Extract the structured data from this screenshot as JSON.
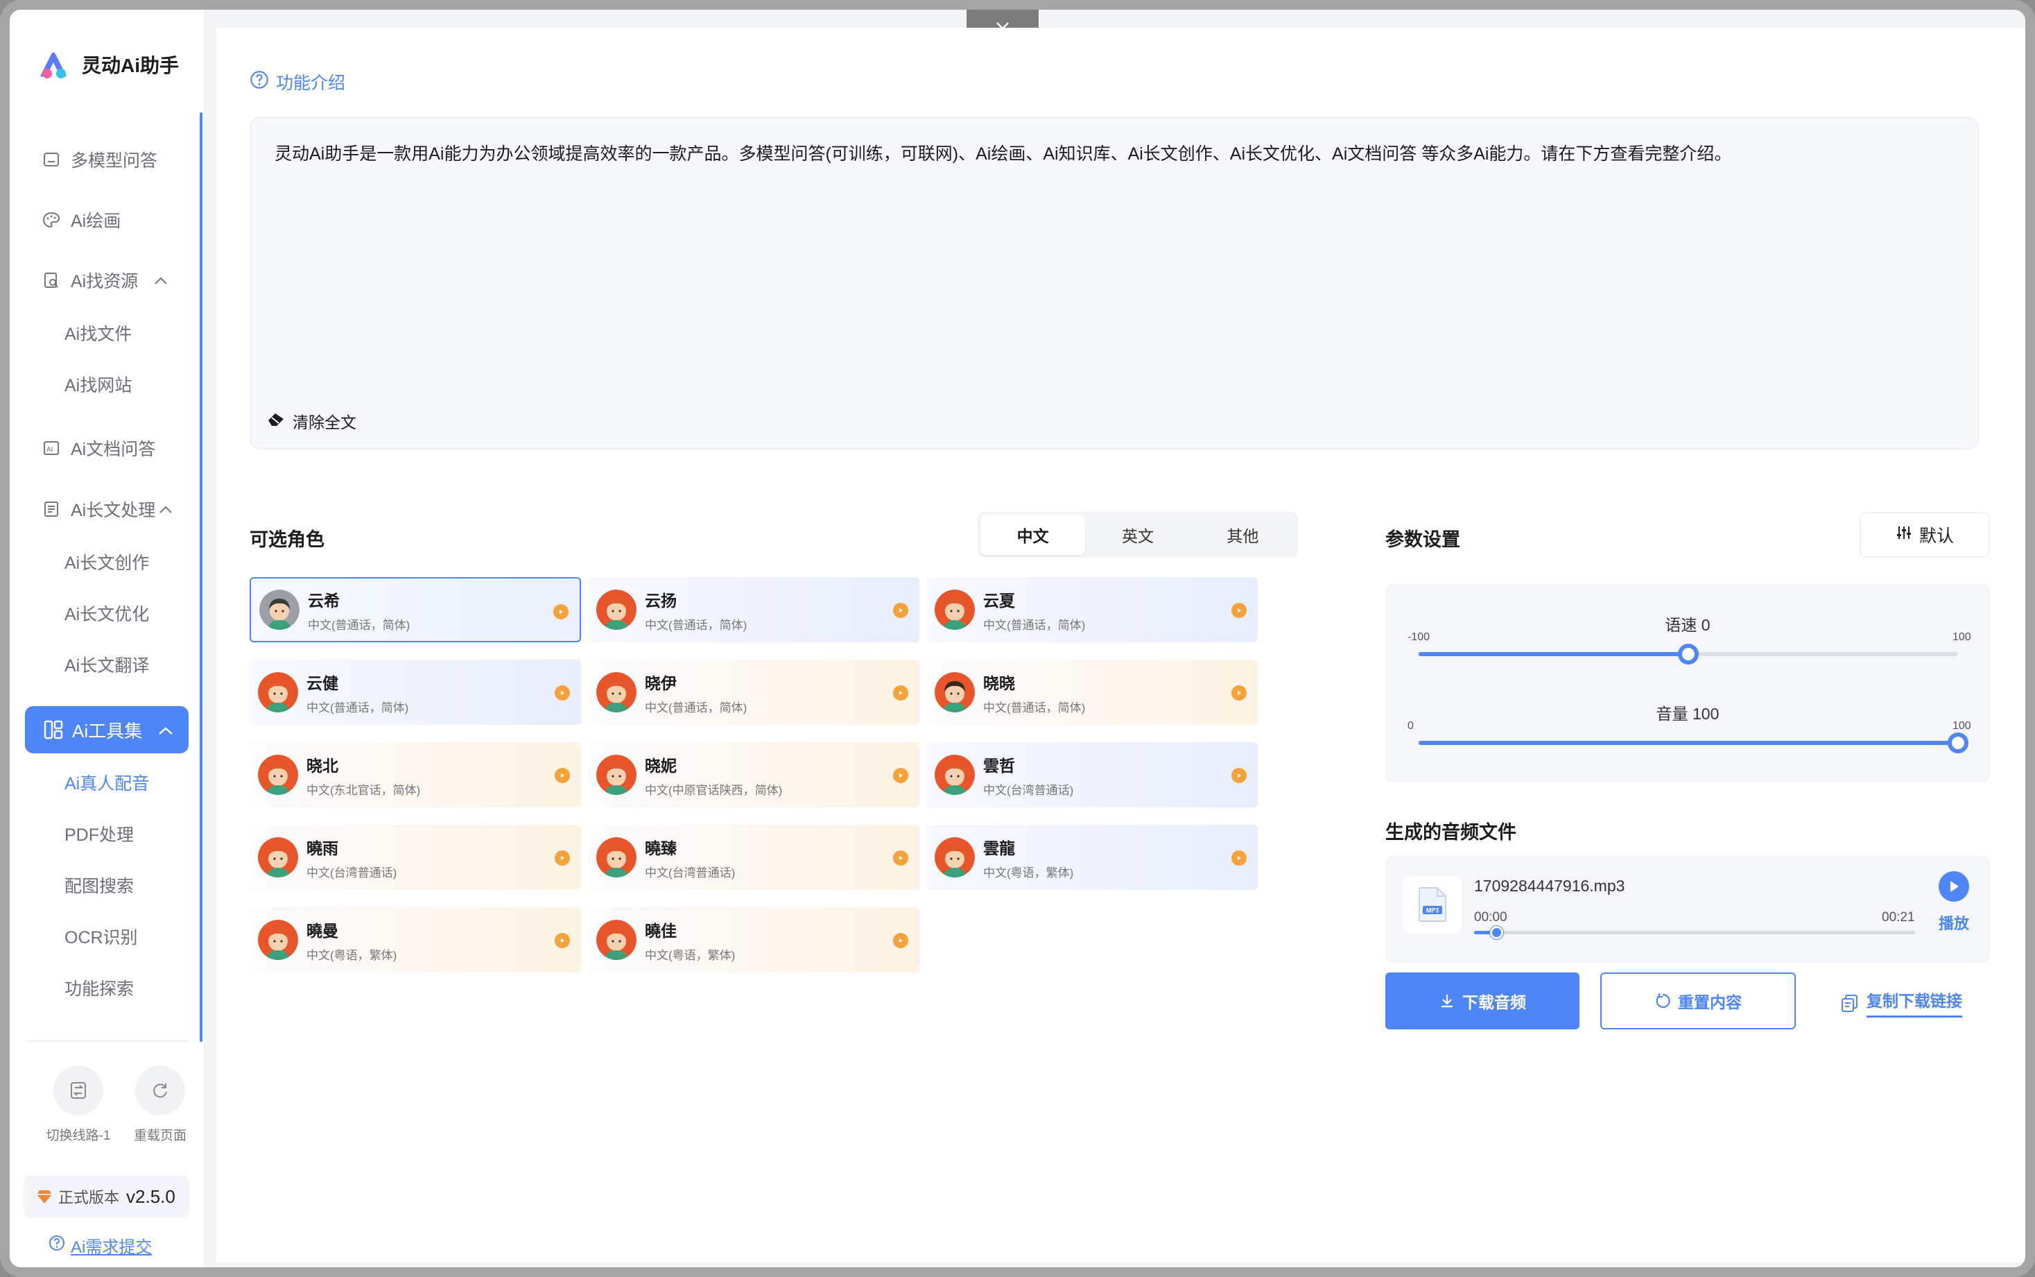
{
  "app": {
    "name": "灵动Ai助手"
  },
  "sidebar": {
    "items": [
      {
        "label": "多模型问答"
      },
      {
        "label": "Ai绘画"
      },
      {
        "label": "Ai找资源"
      },
      {
        "label": "Ai找文件"
      },
      {
        "label": "Ai找网站"
      },
      {
        "label": "Ai文档问答"
      },
      {
        "label": "Ai长文处理"
      },
      {
        "label": "Ai长文创作"
      },
      {
        "label": "Ai长文优化"
      },
      {
        "label": "Ai长文翻译"
      },
      {
        "label": "Ai工具集"
      },
      {
        "label": "Ai真人配音"
      },
      {
        "label": "PDF处理"
      },
      {
        "label": "配图搜索"
      },
      {
        "label": "OCR识别"
      },
      {
        "label": "功能探索"
      }
    ],
    "switch_line": "切换线路-1",
    "reload_page": "重载页面",
    "version_label": "正式版本",
    "version_number": "v2.5.0",
    "feedback": "Ai需求提交"
  },
  "intro": {
    "link": "功能介绍",
    "text": "灵动Ai助手是一款用Ai能力为办公领域提高效率的一款产品。多模型问答(可训练，可联网)、Ai绘画、Ai知识库、Ai长文创作、Ai长文优化、Ai文档问答 等众多Ai能力。请在下方查看完整介绍。",
    "clear": "清除全文"
  },
  "roles": {
    "title": "可选角色",
    "tabs": [
      "中文",
      "英文",
      "其他"
    ],
    "voices": [
      {
        "name": "云希",
        "desc": "中文(普通话，简体)"
      },
      {
        "name": "云扬",
        "desc": "中文(普通话，简体)"
      },
      {
        "name": "云夏",
        "desc": "中文(普通话，简体)"
      },
      {
        "name": "云健",
        "desc": "中文(普通话，简体)"
      },
      {
        "name": "晓伊",
        "desc": "中文(普通话，简体)"
      },
      {
        "name": "晓晓",
        "desc": "中文(普通话，简体)"
      },
      {
        "name": "晓北",
        "desc": "中文(东北官话，简体)"
      },
      {
        "name": "晓妮",
        "desc": "中文(中原官话陕西，简体)"
      },
      {
        "name": "雲哲",
        "desc": "中文(台湾普通话)"
      },
      {
        "name": "曉雨",
        "desc": "中文(台湾普通话)"
      },
      {
        "name": "曉臻",
        "desc": "中文(台湾普通话)"
      },
      {
        "name": "雲龍",
        "desc": "中文(粤语，繁体)"
      },
      {
        "name": "曉曼",
        "desc": "中文(粤语，繁体)"
      },
      {
        "name": "曉佳",
        "desc": "中文(粤语，繁体)"
      }
    ]
  },
  "params": {
    "title": "参数设置",
    "default_btn": "默认",
    "speed": {
      "label": "语速 0",
      "min": "-100",
      "max": "100",
      "value": 0
    },
    "volume": {
      "label": "音量 100",
      "min": "0",
      "max": "100",
      "value": 100
    }
  },
  "audio": {
    "title": "生成的音频文件",
    "file_name": "1709284447916.mp3",
    "file_type": "MP3",
    "current_time": "00:00",
    "duration": "00:21",
    "progress": 0.05,
    "play": "播放"
  },
  "actions": {
    "download": "下载音频",
    "reset": "重置内容",
    "copy_link": "复制下载链接"
  },
  "colors": {
    "accent": "#4e86f7",
    "play_orange": "#f5a23a"
  }
}
